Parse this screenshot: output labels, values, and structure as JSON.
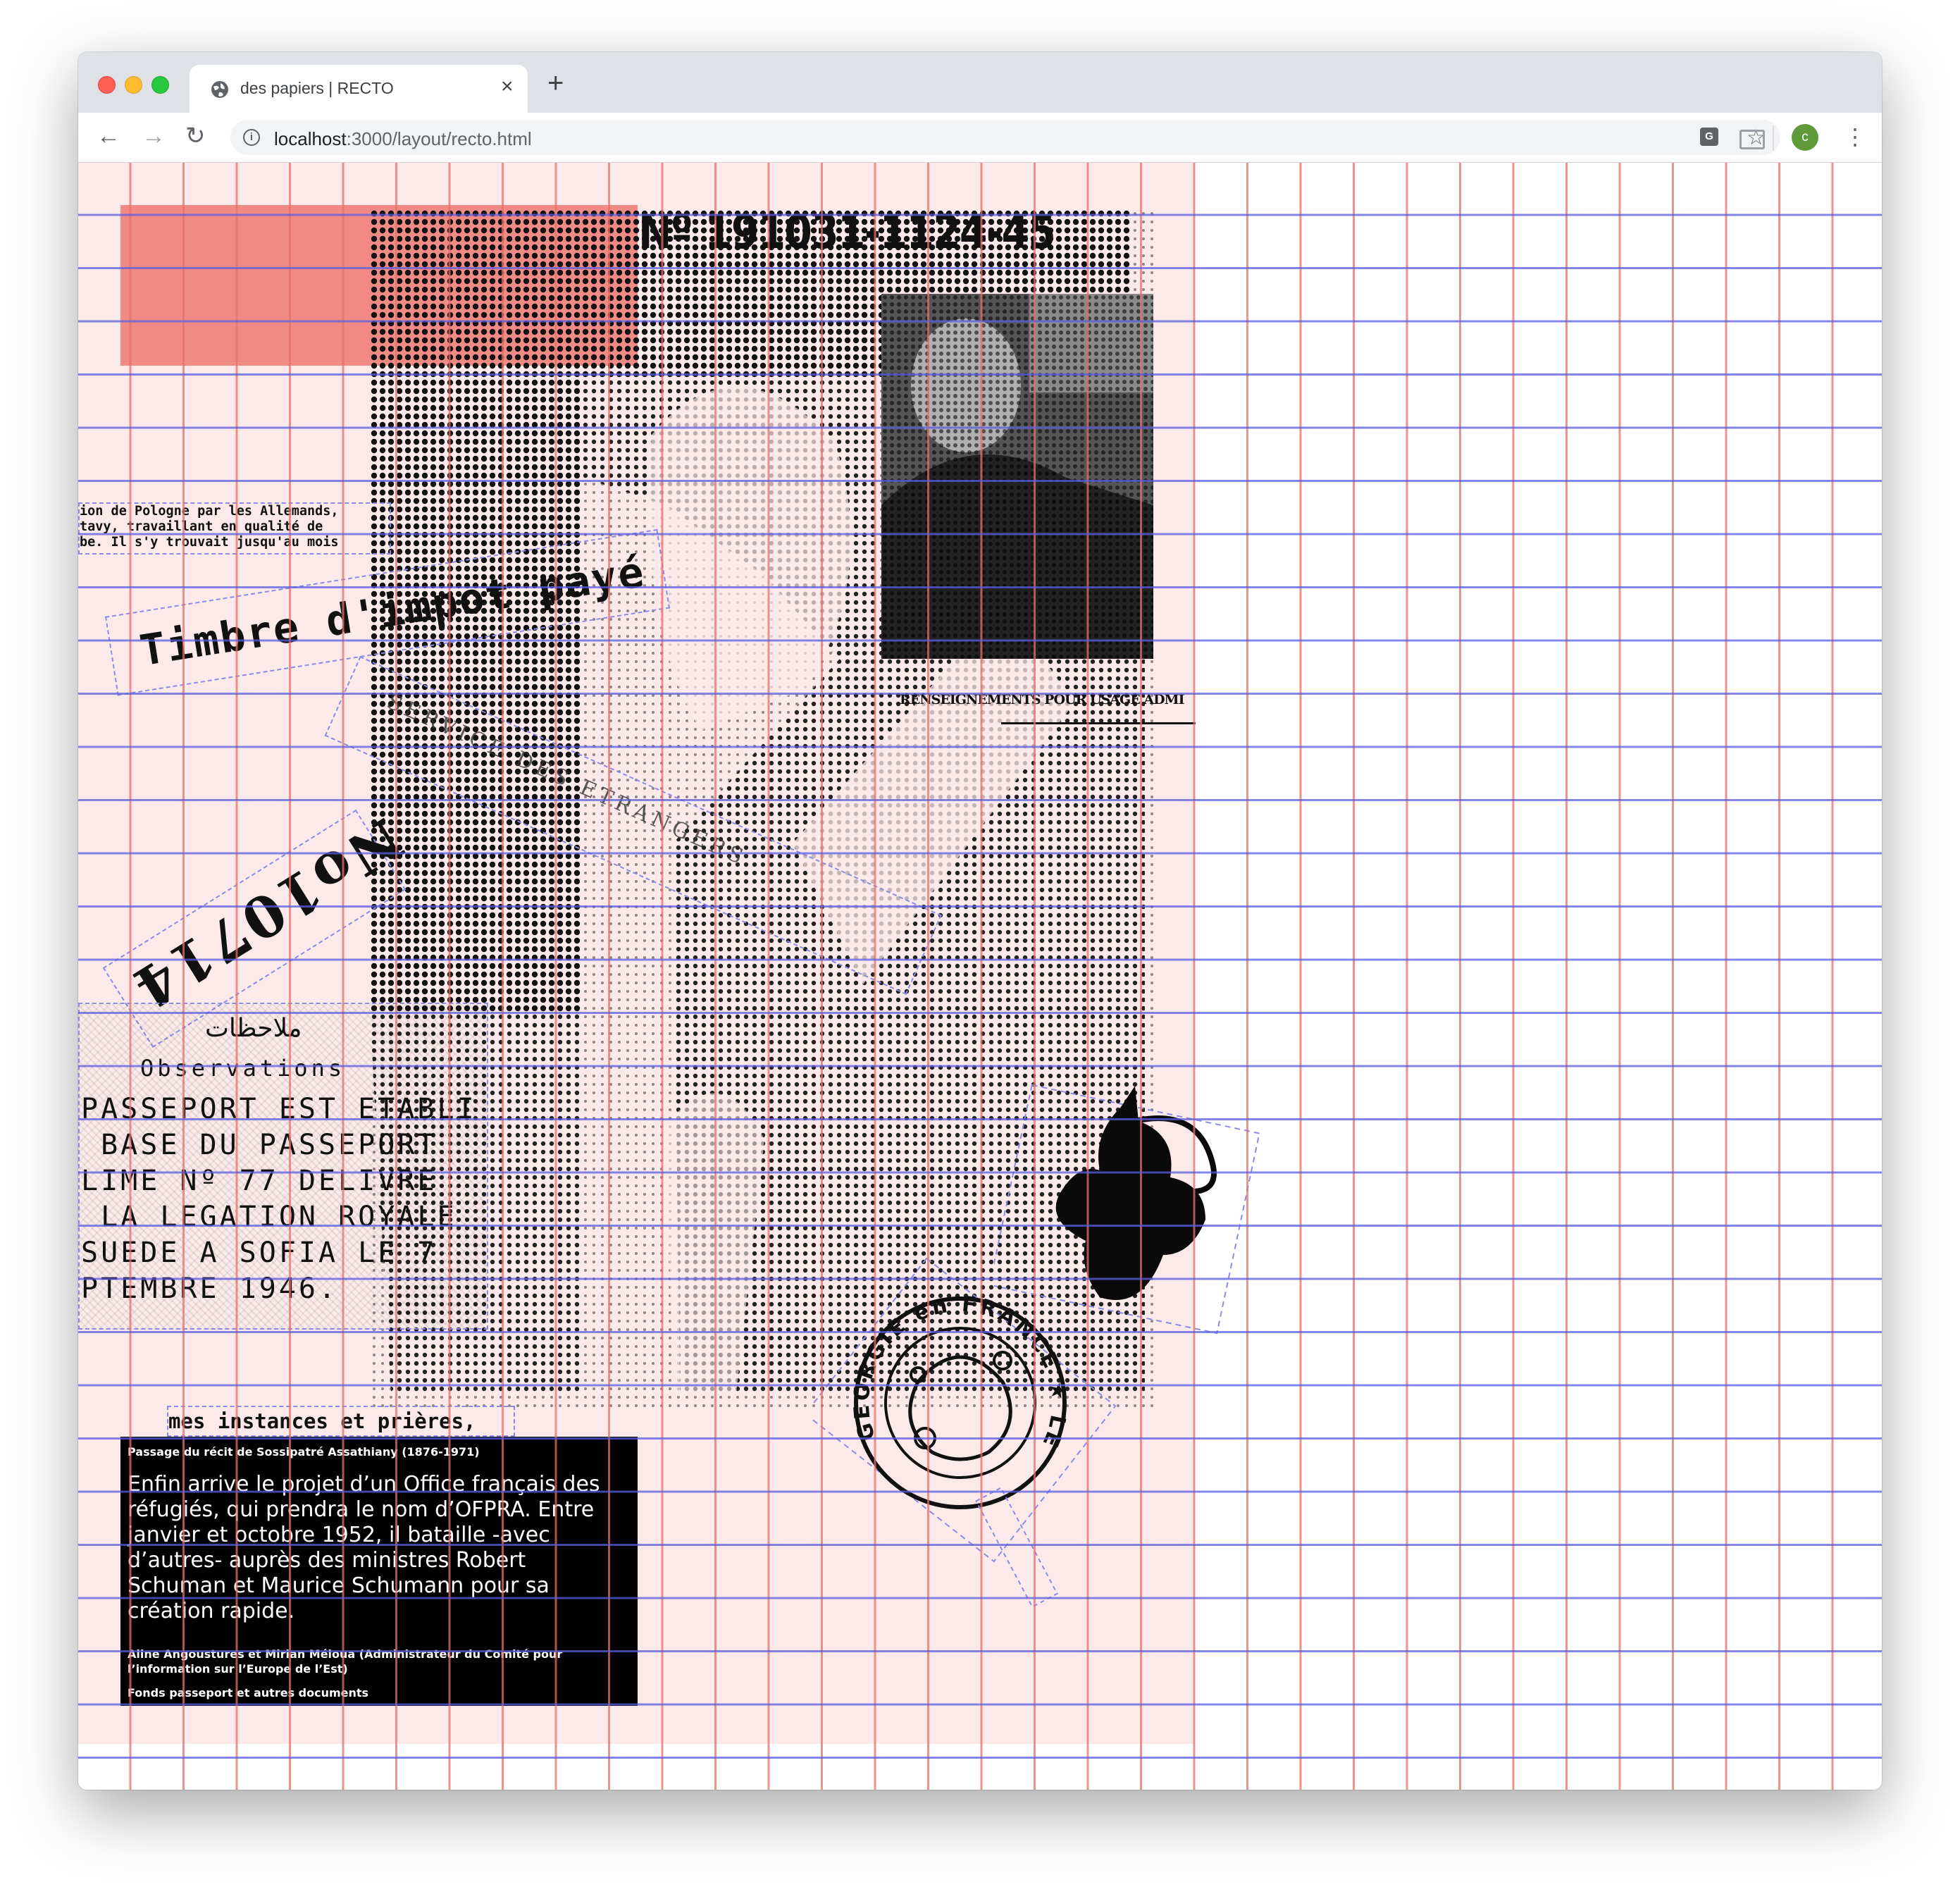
{
  "browser": {
    "tab_title": "des papiers | RECTO",
    "url_host": "localhost",
    "url_rest": ":3000/layout/recto.html",
    "avatar_letter": "c",
    "icons": [
      "back-icon",
      "forward-icon",
      "reload-icon",
      "info-icon",
      "translate-icon",
      "star-icon",
      "cast-icon",
      "more-icon",
      "globe-icon",
      "close-icon",
      "plus-icon"
    ]
  },
  "document": {
    "number": "Nº 191031-1124-45",
    "renseignements": "RENSEIGNEMENTS POUR USAGE ADMI",
    "typed_lines": [
      "ion de Pologne par les Allemands,",
      "tavy, travaillant en qualité de",
      "be. Il s'y trouvait jusqu'au mois"
    ],
    "timbre": "Timbre d'impot payé",
    "stamp_rotated": "SERVICE DES ETRANGERS",
    "num_stamp": "No10714",
    "observations": {
      "arabic": "ملاحظات",
      "title": "Observations",
      "lines": [
        "PASSEPORT EST ETABLI",
        " BASE DU PASSEPORT",
        "LIME Nº 77 DELIVRE",
        " LA LEGATION ROYALE",
        "SUEDE A SOFIA LE 7",
        "PTEMBRE 1946."
      ]
    },
    "instances": "mes instances et prières,",
    "seal_text": "GEORGIE en FRANCE ★ LEGATION de"
  },
  "caption": {
    "source": "Passage du récit de Sossipatré Assathiany (1876-1971)",
    "text": "Enfin arrive le projet d’un Office français des réfugiés, qui prendra le nom d’OFPRA. Entre janvier et octobre 1952, il bataille -avec d’autres- auprès des ministres Robert Schuman et Maurice Schumann pour sa création rapide.",
    "authors": "Aline Angoustures et Mirian Méloua (Administrateur du Comité pour l’information sur l’Europe de l’Est)",
    "fonds": "Fonds passeport et autres documents"
  },
  "colors": {
    "grid_red": "#e8706a",
    "grid_blue": "#5a5ee0",
    "sheet": "#fceaea",
    "accent_rect": "#f0857e"
  }
}
